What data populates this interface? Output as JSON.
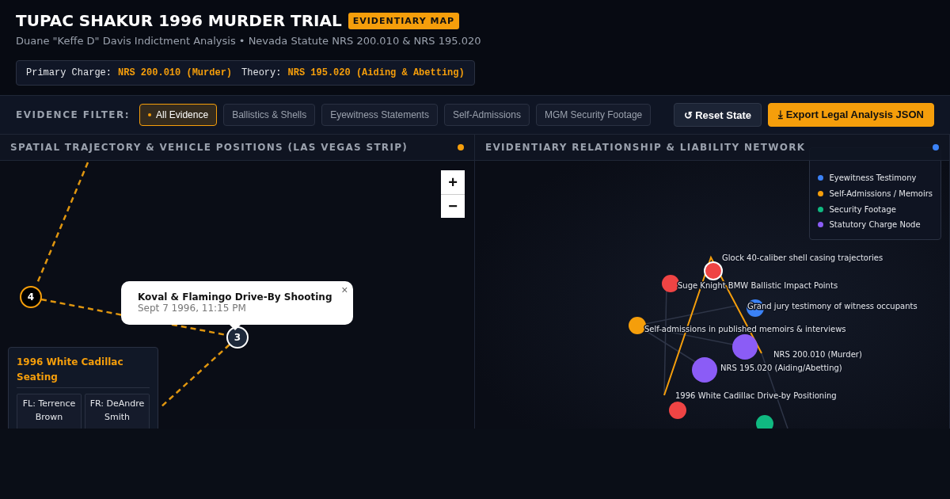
{
  "header": {
    "title": "TUPAC SHAKUR 1996 MURDER TRIAL",
    "badge": "EVIDENTIARY MAP",
    "subtitle": "Duane \"Keffe D\" Davis Indictment Analysis • Nevada Statute NRS 200.010 & NRS 195.020",
    "charges": [
      {
        "label": "Primary Charge:",
        "value": "NRS 200.010 (Murder)"
      },
      {
        "label": "Theory:",
        "value": "NRS 195.020 (Aiding & Abetting)"
      }
    ]
  },
  "filter_bar": {
    "label": "EVIDENCE FILTER:",
    "filters": [
      {
        "label": "All Evidence",
        "selected": true
      },
      {
        "label": "Ballistics & Shells",
        "selected": false
      },
      {
        "label": "Eyewitness Statements",
        "selected": false
      },
      {
        "label": "Self-Admissions",
        "selected": false
      },
      {
        "label": "MGM Security Footage",
        "selected": false
      }
    ],
    "buttons": [
      {
        "label": "↺ Reset State",
        "kind": "secondary"
      },
      {
        "label": "⤓ Export Legal Analysis JSON",
        "kind": "primary"
      }
    ]
  },
  "map_panel": {
    "title": "SPATIAL TRAJECTORY & VEHICLE POSITIONS (LAS VEGAS STRIP)",
    "color": "#f59e0b",
    "zoom_in": "+",
    "zoom_out": "−",
    "markers": [
      {
        "label": "4",
        "highlighted": true
      },
      {
        "label": "3",
        "highlighted": false
      }
    ],
    "popup": {
      "title": "Koval & Flamingo Drive-By Shooting",
      "subtitle": "Sept 7 1996, 11:15 PM",
      "close": "×"
    },
    "seating_card": {
      "title": "1996 White Cadillac Seating",
      "seats": [
        "FL: Terrence Brown",
        "FR: DeAndre Smith"
      ]
    }
  },
  "network_panel": {
    "title": "EVIDENTIARY RELATIONSHIP & LIABILITY NETWORK",
    "color": "#3b82f6",
    "legend": [
      {
        "label": "Eyewitness Testimony",
        "color": "#3b82f6"
      },
      {
        "label": "Self-Admissions / Memoirs",
        "color": "#f59e0b"
      },
      {
        "label": "Security Footage",
        "color": "#10b981"
      },
      {
        "label": "Statutory Charge Node",
        "color": "#8b5cf6"
      }
    ],
    "nodes": [
      {
        "label": "Glock 40-caliber shell casing trajectories",
        "color": "#ef4444",
        "selected": true
      },
      {
        "label": "Suge Knight BMW Ballistic Impact Points",
        "color": "#ef4444",
        "selected": false
      },
      {
        "label": "Grand jury testimony of witness occupants",
        "color": "#3b82f6",
        "selected": false
      },
      {
        "label": "Self-admissions in published memoirs & interviews",
        "color": "#f59e0b",
        "selected": false
      },
      {
        "label": "NRS 200.010 (Murder)",
        "color": "#8b5cf6",
        "selected": false
      },
      {
        "label": "NRS 195.020 (Aiding/Abetting)",
        "color": "#8b5cf6",
        "selected": false
      },
      {
        "label": "1996 White Cadillac Drive-by Positioning",
        "color": "#ef4444",
        "selected": false
      },
      {
        "color": "#10b981",
        "selected": false
      }
    ]
  }
}
